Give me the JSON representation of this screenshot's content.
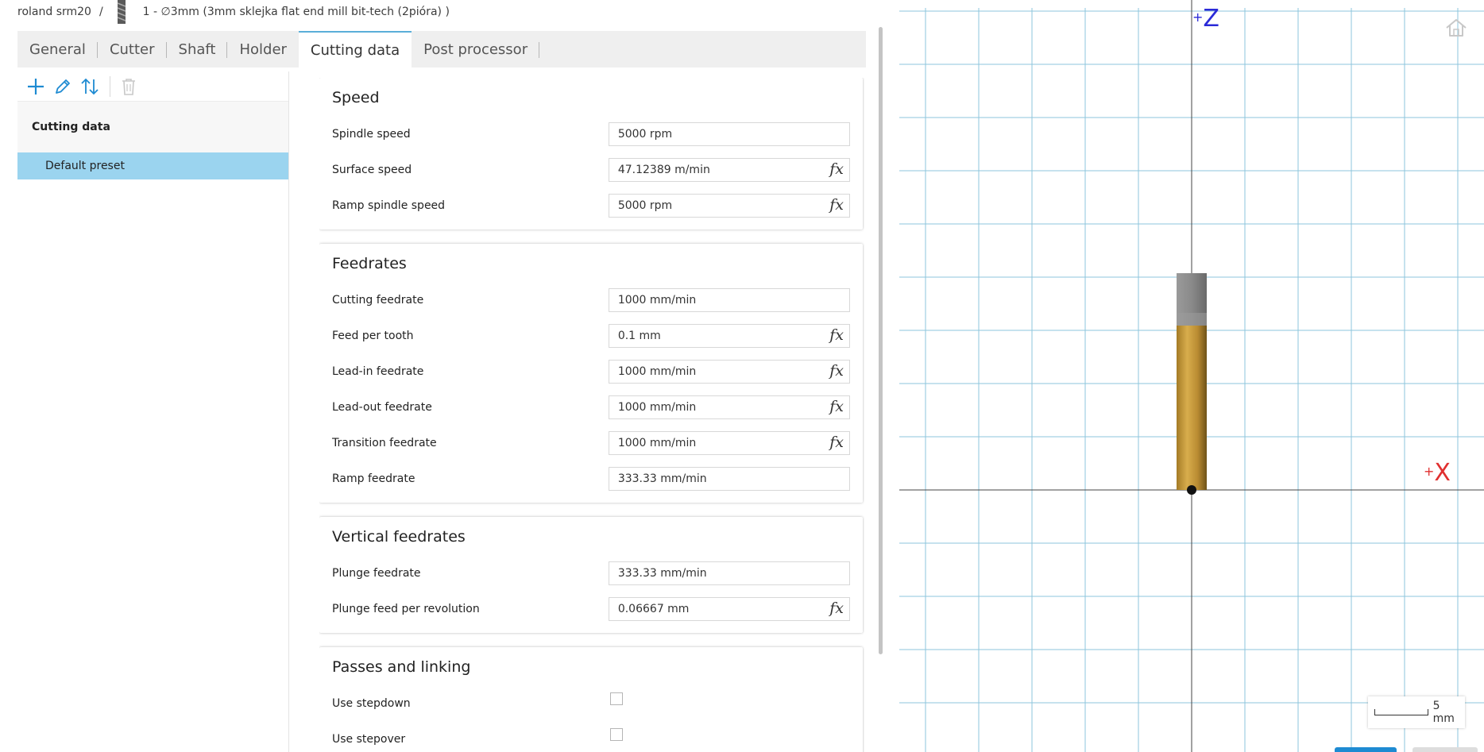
{
  "breadcrumb": {
    "machine": "roland srm20",
    "separator": "/",
    "tool": "1 - ∅3mm (3mm sklejka flat end mill bit-tech (2pióra) )"
  },
  "tabs": [
    {
      "label": "General",
      "active": false
    },
    {
      "label": "Cutter",
      "active": false
    },
    {
      "label": "Shaft",
      "active": false
    },
    {
      "label": "Holder",
      "active": false
    },
    {
      "label": "Cutting data",
      "active": true
    },
    {
      "label": "Post processor",
      "active": false
    }
  ],
  "toolbar": {
    "add_icon": "plus-icon",
    "edit_icon": "pencil-icon",
    "sort_icon": "sort-arrows-icon",
    "delete_icon": "trash-icon"
  },
  "tree": {
    "header": "Cutting data",
    "items": [
      {
        "label": "Default preset",
        "selected": true
      }
    ]
  },
  "speed": {
    "title": "Speed",
    "spindle_speed": {
      "label": "Spindle speed",
      "value": "5000 rpm"
    },
    "surface_speed": {
      "label": "Surface speed",
      "value": "47.12389 m/min"
    },
    "ramp_spindle_speed": {
      "label": "Ramp spindle speed",
      "value": "5000 rpm"
    }
  },
  "feedrates": {
    "title": "Feedrates",
    "cutting_feedrate": {
      "label": "Cutting feedrate",
      "value": "1000 mm/min"
    },
    "feed_per_tooth": {
      "label": "Feed per tooth",
      "value": "0.1 mm"
    },
    "lead_in_feedrate": {
      "label": "Lead-in feedrate",
      "value": "1000 mm/min"
    },
    "lead_out_feedrate": {
      "label": "Lead-out feedrate",
      "value": "1000 mm/min"
    },
    "transition_feedrate": {
      "label": "Transition feedrate",
      "value": "1000 mm/min"
    },
    "ramp_feedrate": {
      "label": "Ramp feedrate",
      "value": "333.33 mm/min"
    }
  },
  "vertical_feedrates": {
    "title": "Vertical feedrates",
    "plunge_feedrate": {
      "label": "Plunge feedrate",
      "value": "333.33 mm/min"
    },
    "plunge_feed_per_revolution": {
      "label": "Plunge feed per revolution",
      "value": "0.06667 mm"
    }
  },
  "passes_linking": {
    "title": "Passes and linking",
    "use_stepdown": {
      "label": "Use stepdown",
      "checked": false
    },
    "use_stepover": {
      "label": "Use stepover",
      "checked": false
    }
  },
  "fx_symbol": "fx",
  "viewport": {
    "z_axis": {
      "sign": "+",
      "letter": "Z"
    },
    "x_axis": {
      "sign": "+",
      "letter": "X"
    },
    "scale_label": "5 mm",
    "home_icon": "home-icon"
  },
  "colors": {
    "tab_active_border": "#5aaed9",
    "selection": "#9bd4ef",
    "grid": "#8ec6dc",
    "z_axis": "#2a2ad8",
    "x_axis": "#e03030",
    "tool_body": "#c99a3a",
    "tool_holder": "#8a8a8a",
    "accent_icon": "#1e8bd2"
  }
}
